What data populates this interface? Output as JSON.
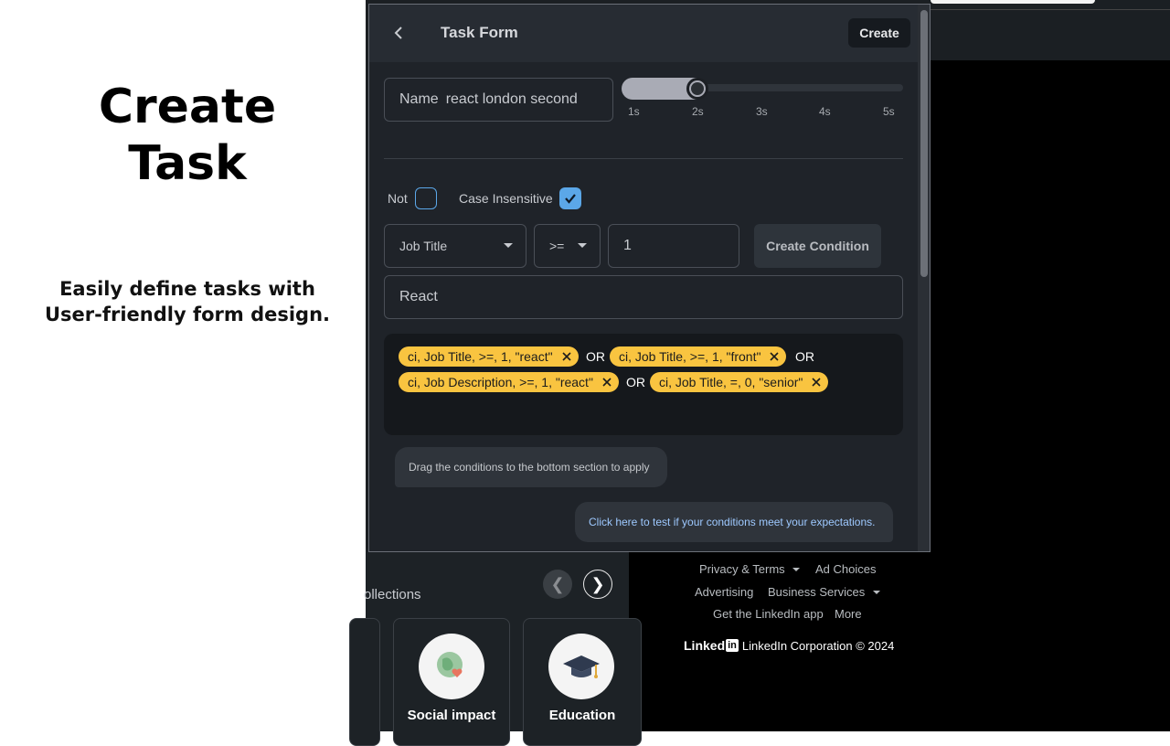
{
  "promo": {
    "title_line1": "Create",
    "title_line2": "Task",
    "desc_line1": "Easily define tasks with",
    "desc_line2": "User-friendly form design."
  },
  "form": {
    "title": "Task Form",
    "create_label": "Create",
    "name_label": "Name",
    "name_value": "react london second",
    "slider": {
      "ticks": [
        "1s",
        "2s",
        "3s",
        "4s",
        "5s"
      ],
      "value": "2s"
    },
    "not_label": "Not",
    "not_checked": false,
    "case_insensitive_label": "Case Insensitive",
    "case_insensitive_checked": true,
    "field_select": "Job Title",
    "operator_select": ">=",
    "count_value": "1",
    "create_condition_label": "Create Condition",
    "value_input": "React",
    "conditions": [
      "ci, Job Title, >=, 1, \"react\"",
      "ci, Job Title, >=, 1, \"front\"",
      "ci, Job Description, >=, 1, \"react\"",
      "ci, Job Title, =, 0, \"senior\""
    ],
    "or_label": "OR",
    "hint_drag": "Drag the conditions to the bottom section to apply",
    "hint_test": "Click here to test if your conditions meet your expectations."
  },
  "background": {
    "collections_label": "ollections",
    "prev_arrow": "❮",
    "next_arrow": "❯",
    "cards": [
      "Social impact",
      "Education"
    ],
    "footer_links": [
      "Privacy & Terms",
      "Ad Choices",
      "Advertising",
      "Business Services",
      "Get the LinkedIn app",
      "More"
    ],
    "logo_text": "Linked",
    "logo_in": "in",
    "corporation": "LinkedIn Corporation © 2024"
  },
  "colors": {
    "chip": "#f9c440",
    "checkbox": "#5ba7e8",
    "panel": "#1f2329"
  }
}
